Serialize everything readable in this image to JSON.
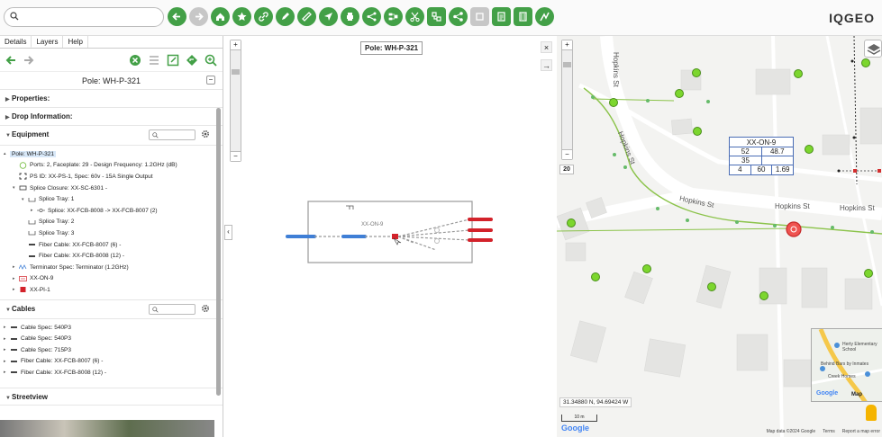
{
  "app": {
    "brand": "IQGEO"
  },
  "search": {
    "placeholder": ""
  },
  "toolbar": {
    "tools": [
      "back-icon",
      "forward-icon",
      "home-icon",
      "star-icon",
      "link-icon",
      "pencil-icon",
      "ruler-icon",
      "navigate-icon",
      "print-icon",
      "share-icon",
      "network-icon",
      "scissors-icon",
      "network-trace-icon",
      "connect-icon",
      "disabled-icon",
      "document-icon",
      "list-icon",
      "signal-icon"
    ]
  },
  "left_panel": {
    "tabs": [
      "Details",
      "Layers",
      "Help"
    ],
    "title": "Pole: WH-P-321",
    "sections": {
      "properties": "Properties:",
      "drop_info": "Drop Information:",
      "equipment": "Equipment",
      "cables": "Cables",
      "streetview": "Streetview"
    },
    "equipment_tree": [
      {
        "depth": 0,
        "toggle": "▴",
        "icon": "none",
        "label": "Pole: WH-P-321",
        "selected": true
      },
      {
        "depth": 1,
        "toggle": "",
        "icon": "circle",
        "label": "Ports: 2, Faceplate: 29 - Design Frequency: 1.2GHz (dB)"
      },
      {
        "depth": 1,
        "toggle": "",
        "icon": "bracket",
        "label": "PS ID: XX-PS-1, Spec: 60v - 15A Single Output"
      },
      {
        "depth": 1,
        "toggle": "▾",
        "icon": "rect",
        "label": "Splice Closure: XX-SC-6301 -"
      },
      {
        "depth": 2,
        "toggle": "▾",
        "icon": "tray",
        "label": "Splice Tray: 1"
      },
      {
        "depth": 3,
        "toggle": "▸",
        "icon": "splice",
        "label": "Splice: XX-FCB-8008 -> XX-FCB-8007 (2)"
      },
      {
        "depth": 2,
        "toggle": "",
        "icon": "tray",
        "label": "Splice Tray: 2"
      },
      {
        "depth": 2,
        "toggle": "",
        "icon": "tray",
        "label": "Splice Tray: 3"
      },
      {
        "depth": 2,
        "toggle": "",
        "icon": "cable",
        "label": "Fiber Cable: XX-FCB-8007 (6) -"
      },
      {
        "depth": 2,
        "toggle": "",
        "icon": "cable",
        "label": "Fiber Cable: XX-FCB-8008 (12) -"
      },
      {
        "depth": 1,
        "toggle": "▸",
        "icon": "zigzag",
        "label": "Terminator Spec: Terminator (1.2GHz)"
      },
      {
        "depth": 1,
        "toggle": "▸",
        "icon": "onbox",
        "label": "XX-ON-9"
      },
      {
        "depth": 1,
        "toggle": "▸",
        "icon": "redsq",
        "label": "XX-PI-1"
      }
    ],
    "cables_tree": [
      {
        "depth": 0,
        "toggle": "▸",
        "icon": "cable",
        "label": "Cable Spec: 540P3"
      },
      {
        "depth": 0,
        "toggle": "▸",
        "icon": "cable",
        "label": "Cable Spec: 540P3"
      },
      {
        "depth": 0,
        "toggle": "▸",
        "icon": "cable",
        "label": "Cable Spec: 715P3"
      },
      {
        "depth": 0,
        "toggle": "▸",
        "icon": "cable",
        "label": "Fiber Cable: XX-FCB-8007 (6) -"
      },
      {
        "depth": 0,
        "toggle": "▸",
        "icon": "cable",
        "label": "Fiber Cable: XX-FCB-8008 (12) -"
      }
    ]
  },
  "schematic": {
    "pole_label": "Pole: WH-P-321",
    "node_label": "XX-ON-9",
    "close_label": "×",
    "next_label": "→"
  },
  "map": {
    "zoom_level": "20",
    "coords": "31.34880 N, 94.69424 W",
    "scale": "10 m",
    "google": "Google",
    "streets": [
      "Hopkins St",
      "Hopkins St",
      "Hopkins St",
      "Hopkins St",
      "Hopkins St"
    ],
    "table": {
      "title": "XX-ON-9",
      "rows": [
        [
          "52",
          "48.7"
        ],
        [
          "35"
        ],
        [
          "4",
          "60",
          "1.69"
        ]
      ]
    },
    "inset": {
      "school": "Herty Elementary School",
      "place1": "Behind Bars by Inmates",
      "place2": "Creek Homes",
      "logo": "Google",
      "label": "Map"
    },
    "attribution": [
      "Map data ©2024 Google",
      "Terms",
      "Report a map error"
    ]
  },
  "colors": {
    "accent": "#43a047",
    "cable_blue": "#3f7fd6",
    "cable_red": "#d3222a",
    "pole_red": "#e53935"
  }
}
